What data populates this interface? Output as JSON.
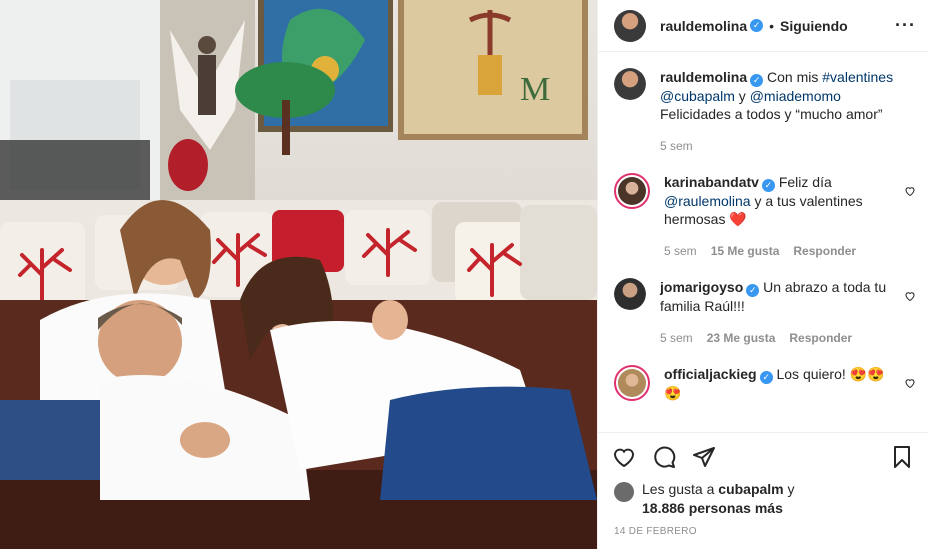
{
  "post": {
    "username": "rauldemolina",
    "follow_status": "Siguiendo",
    "more_icon": "more-horizontal-icon"
  },
  "caption": {
    "username": "rauldemolina",
    "text_prefix": "Con mis ",
    "hashtag": "#valentines",
    "mention1": "@cubapalm",
    "connector": " y ",
    "mention2": "@miademomo",
    "line2": "Felicidades a todos y “mucho amor”",
    "time": "5 sem"
  },
  "comments": [
    {
      "username": "karinabandatv",
      "text_prefix": "Feliz día",
      "mention": "@raulemolina",
      "text_suffix": " y a tus valentines hermosas ❤️",
      "time": "5 sem",
      "likes": "15 Me gusta",
      "reply": "Responder"
    },
    {
      "username": "jomarigoyso",
      "text": "Un abrazo a toda tu familia Raúl!!!",
      "time": "5 sem",
      "likes": "23 Me gusta",
      "reply": "Responder"
    },
    {
      "username": "officialjackieg",
      "text": "Los quiero! 😍😍😍"
    }
  ],
  "likes": {
    "prefix": "Les gusta a ",
    "user": "cubapalm",
    "connector": " y",
    "count": "18.886 personas más"
  },
  "date": "14 DE FEBRERO",
  "colors": {
    "verified": "#3897f0",
    "link": "#00376b",
    "muted": "#8e8e8e",
    "story_ring": "#e1306c"
  }
}
